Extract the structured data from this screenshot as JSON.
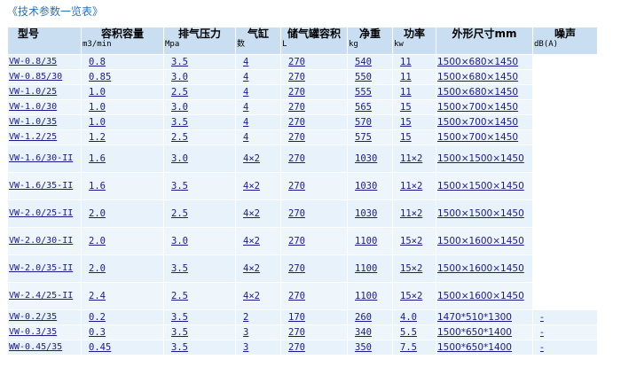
{
  "caption": "《技术参数一览表》",
  "headers": [
    {
      "name": "型号",
      "unit": ""
    },
    {
      "name": "容积容量",
      "unit": "m3/min"
    },
    {
      "name": "排气压力",
      "unit": "Mpa"
    },
    {
      "name": "气缸",
      "unit": "数"
    },
    {
      "name": "储气罐容积",
      "unit": "L"
    },
    {
      "name": "净重",
      "unit": "kg"
    },
    {
      "name": "功率",
      "unit": "kw"
    },
    {
      "name": "外形尺寸mm",
      "unit": ""
    },
    {
      "name": "噪声",
      "unit": "dB(A)"
    }
  ],
  "rows": [
    {
      "model": "VW-0.8/35",
      "capacity": "0.8",
      "pressure": "3.5",
      "cylinders": "4",
      "tank": "270",
      "weight": "540",
      "power": "11",
      "size": "1500×680×1450",
      "noise": ""
    },
    {
      "model": "VW-0.85/30",
      "capacity": "0.85",
      "pressure": "3.0",
      "cylinders": "4",
      "tank": "270",
      "weight": "550",
      "power": "11",
      "size": "1500×680×1450",
      "noise": ""
    },
    {
      "model": "VW-1.0/25",
      "capacity": "1.0",
      "pressure": "2.5",
      "cylinders": "4",
      "tank": "270",
      "weight": "555",
      "power": "11",
      "size": "1500×680×1450",
      "noise": ""
    },
    {
      "model": "VW-1.0/30",
      "capacity": "1.0",
      "pressure": "3.0",
      "cylinders": "4",
      "tank": "270",
      "weight": "565",
      "power": "15",
      "size": "1500×700×1450",
      "noise": ""
    },
    {
      "model": "VW-1.0/35",
      "capacity": "1.0",
      "pressure": "3.5",
      "cylinders": "4",
      "tank": "270",
      "weight": "570",
      "power": "15",
      "size": "1500×700×1450",
      "noise": ""
    },
    {
      "model": "VW-1.2/25",
      "capacity": "1.2",
      "pressure": "2.5",
      "cylinders": "4",
      "tank": "270",
      "weight": "575",
      "power": "15",
      "size": "1500×700×1450",
      "noise": ""
    },
    {
      "model": "VW-1.6/30-II",
      "capacity": "1.6",
      "pressure": "3.0",
      "cylinders": "4×2",
      "tank": "270",
      "weight": "1030",
      "power": "11×2",
      "size": "1500×1500×1450",
      "noise": ""
    },
    {
      "model": "VW-1.6/35-II",
      "capacity": "1.6",
      "pressure": "3.5",
      "cylinders": "4×2",
      "tank": "270",
      "weight": "1030",
      "power": "11×2",
      "size": "1500×1500×1450",
      "noise": ""
    },
    {
      "model": "VW-2.0/25-II",
      "capacity": "2.0",
      "pressure": "2.5",
      "cylinders": "4×2",
      "tank": "270",
      "weight": "1030",
      "power": "11×2",
      "size": "1500×1500×1450",
      "noise": ""
    },
    {
      "model": "VW-2.0/30-II",
      "capacity": "2.0",
      "pressure": "3.0",
      "cylinders": "4×2",
      "tank": "270",
      "weight": "1100",
      "power": "15×2",
      "size": "1500×1600×1450",
      "noise": ""
    },
    {
      "model": "VW-2.0/35-II",
      "capacity": "2.0",
      "pressure": "3.5",
      "cylinders": "4×2",
      "tank": "270",
      "weight": "1100",
      "power": "15×2",
      "size": "1500×1600×1450",
      "noise": ""
    },
    {
      "model": "VW-2.4/25-II",
      "capacity": "2.4",
      "pressure": "2.5",
      "cylinders": "4×2",
      "tank": "270",
      "weight": "1100",
      "power": "15×2",
      "size": "1500×1600×1450",
      "noise": ""
    },
    {
      "model": "VW-0.2/35",
      "capacity": "0.2",
      "pressure": "3.5",
      "cylinders": "2",
      "tank": "170",
      "weight": "260",
      "power": "4.0",
      "size": "1470*510*1300",
      "noise": "-"
    },
    {
      "model": "VW-0.3/35",
      "capacity": "0.3",
      "pressure": "3.5",
      "cylinders": "3",
      "tank": "270",
      "weight": "340",
      "power": "5.5",
      "size": "1500*650*1400",
      "noise": "-"
    },
    {
      "model": "WW-0.45/35",
      "capacity": "0.45",
      "pressure": "3.5",
      "cylinders": "3",
      "tank": "270",
      "weight": "350",
      "power": "7.5",
      "size": "1500*650*1400",
      "noise": "-"
    }
  ]
}
